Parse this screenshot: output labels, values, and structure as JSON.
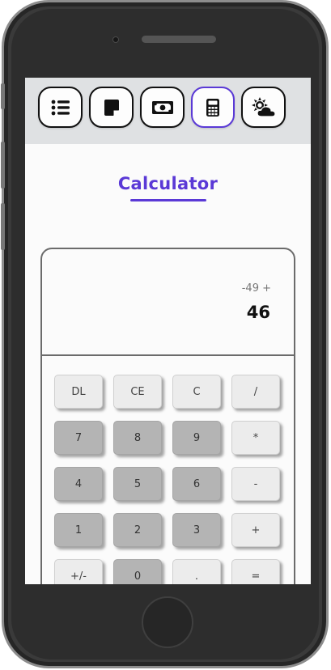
{
  "nav": {
    "items": [
      {
        "name": "list",
        "icon": "list-icon"
      },
      {
        "name": "notes",
        "icon": "sticky-note-icon"
      },
      {
        "name": "money",
        "icon": "money-bill-icon"
      },
      {
        "name": "calculator",
        "icon": "calculator-icon",
        "active": true
      },
      {
        "name": "weather",
        "icon": "sun-cloud-icon"
      }
    ]
  },
  "page": {
    "title": "Calculator"
  },
  "calculator": {
    "expression": "-49 +",
    "result": "46",
    "keys": [
      {
        "label": "DL",
        "style": "light"
      },
      {
        "label": "CE",
        "style": "light"
      },
      {
        "label": "C",
        "style": "light"
      },
      {
        "label": "/",
        "style": "light"
      },
      {
        "label": "7",
        "style": "dark"
      },
      {
        "label": "8",
        "style": "dark"
      },
      {
        "label": "9",
        "style": "dark"
      },
      {
        "label": "*",
        "style": "light"
      },
      {
        "label": "4",
        "style": "dark"
      },
      {
        "label": "5",
        "style": "dark"
      },
      {
        "label": "6",
        "style": "dark"
      },
      {
        "label": "-",
        "style": "light"
      },
      {
        "label": "1",
        "style": "dark"
      },
      {
        "label": "2",
        "style": "dark"
      },
      {
        "label": "3",
        "style": "dark"
      },
      {
        "label": "+",
        "style": "light"
      },
      {
        "label": "+/-",
        "style": "light"
      },
      {
        "label": "0",
        "style": "dark"
      },
      {
        "label": ".",
        "style": "light"
      },
      {
        "label": "=",
        "style": "light"
      }
    ]
  },
  "colors": {
    "accent": "#5a39d6",
    "key_light": "#ececec",
    "key_dark": "#b4b4b4"
  }
}
